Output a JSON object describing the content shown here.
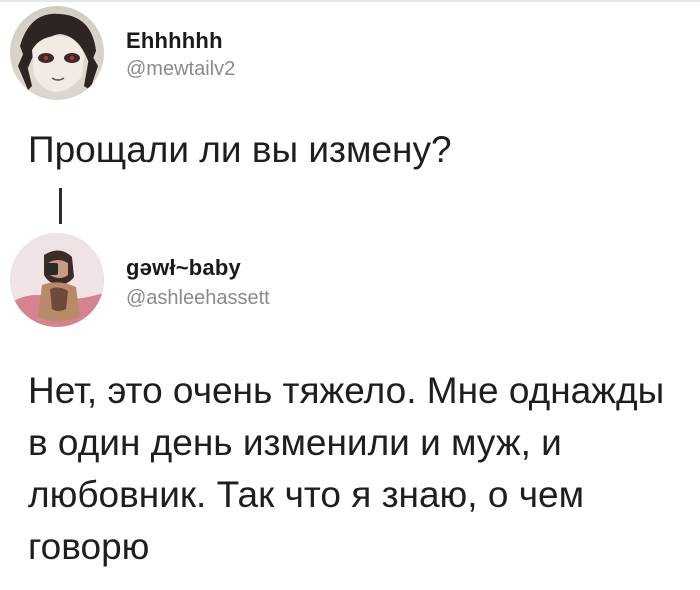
{
  "tweets": [
    {
      "user": {
        "name": "Ehhhhhh",
        "handle": "@mewtailv2"
      },
      "text": "Прощали ли вы измену?"
    },
    {
      "user": {
        "name": "gəwł~baby",
        "handle": "@ashleehassett"
      },
      "text": "Нет, это очень тяжело. Мне однажды в один день изменили и муж, и любовник. Так что я знаю, о чем говорю"
    }
  ],
  "colors": {
    "text": "#1e1e1e",
    "handle": "#8a8a8a",
    "background": "#ffffff"
  }
}
